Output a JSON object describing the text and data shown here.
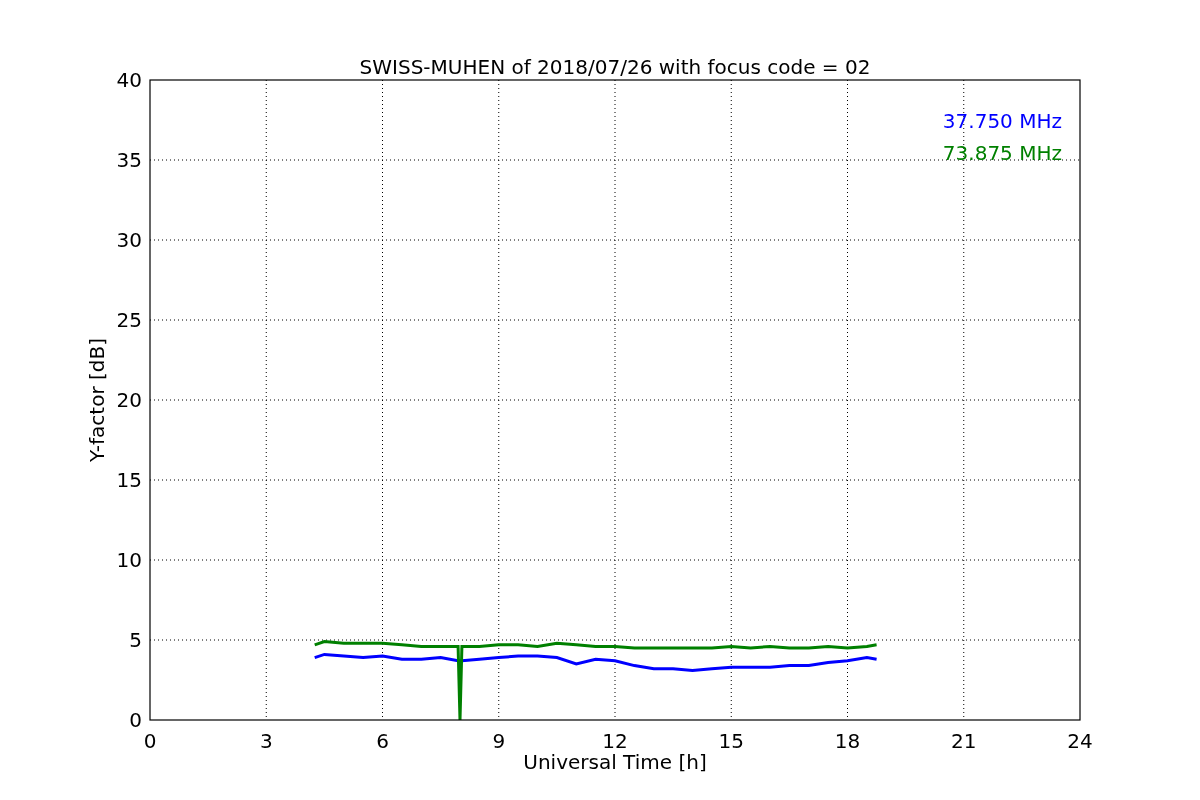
{
  "figure": {
    "chart_data": {
      "type": "line",
      "title": "SWISS-MUHEN of 2018/07/26 with focus code = 02",
      "xlabel": "Universal Time [h]",
      "ylabel": "Y-factor [dB]",
      "x": [
        4.25,
        4.5,
        5,
        5.5,
        6,
        6.5,
        7,
        7.5,
        7.95,
        8,
        8.05,
        8.5,
        9,
        9.5,
        10,
        10.5,
        11,
        11.5,
        12,
        12.5,
        13,
        13.5,
        14,
        14.5,
        15,
        15.5,
        16,
        16.5,
        17,
        17.5,
        18,
        18.5,
        18.75
      ],
      "series": [
        {
          "name": "37.750 MHz",
          "color": "#0000ff",
          "values": [
            3.9,
            4.1,
            4.0,
            3.9,
            4.0,
            3.8,
            3.8,
            3.9,
            3.7,
            3.7,
            3.7,
            3.8,
            3.9,
            4.0,
            4.0,
            3.9,
            3.5,
            3.8,
            3.7,
            3.4,
            3.2,
            3.2,
            3.1,
            3.2,
            3.3,
            3.3,
            3.3,
            3.4,
            3.4,
            3.6,
            3.7,
            3.9,
            3.8
          ]
        },
        {
          "name": "73.875 MHz",
          "color": "#008000",
          "values": [
            4.7,
            4.9,
            4.8,
            4.8,
            4.8,
            4.7,
            4.6,
            4.6,
            4.6,
            0,
            4.6,
            4.6,
            4.7,
            4.7,
            4.6,
            4.8,
            4.7,
            4.6,
            4.6,
            4.5,
            4.5,
            4.5,
            4.5,
            4.5,
            4.6,
            4.5,
            4.6,
            4.5,
            4.5,
            4.6,
            4.5,
            4.6,
            4.7
          ]
        }
      ],
      "grid": true,
      "xlim": [
        0,
        24
      ],
      "ylim": [
        0,
        40
      ],
      "xticks": [
        0,
        3,
        6,
        9,
        12,
        15,
        18,
        21,
        24
      ],
      "yticks": [
        0,
        5,
        10,
        15,
        20,
        25,
        30,
        35,
        40
      ]
    }
  }
}
